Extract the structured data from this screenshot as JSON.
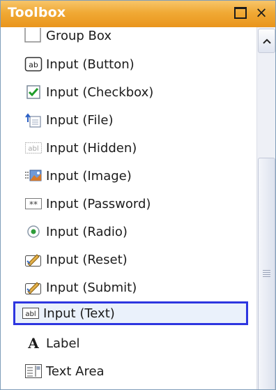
{
  "panel": {
    "title": "Toolbox",
    "maximize_label": "□",
    "close_label": "×"
  },
  "items": [
    {
      "label": "Group Box",
      "icon": "group-box-icon"
    },
    {
      "label": "Input (Button)",
      "icon": "input-button-icon"
    },
    {
      "label": "Input (Checkbox)",
      "icon": "checkbox-icon"
    },
    {
      "label": "Input (File)",
      "icon": "file-input-icon"
    },
    {
      "label": "Input (Hidden)",
      "icon": "hidden-input-icon"
    },
    {
      "label": "Input (Image)",
      "icon": "image-input-icon"
    },
    {
      "label": "Input (Password)",
      "icon": "password-input-icon"
    },
    {
      "label": "Input (Radio)",
      "icon": "radio-icon"
    },
    {
      "label": "Input (Reset)",
      "icon": "reset-input-icon"
    },
    {
      "label": "Input (Submit)",
      "icon": "submit-input-icon"
    },
    {
      "label": "Input (Text)",
      "icon": "text-input-icon",
      "selected": true
    },
    {
      "label": "Label",
      "icon": "label-icon"
    },
    {
      "label": "Text Area",
      "icon": "text-area-icon"
    }
  ],
  "colors": {
    "titlebar": "#f0a935",
    "selection_border": "#2d36e0",
    "title_text": "#ffffff"
  }
}
